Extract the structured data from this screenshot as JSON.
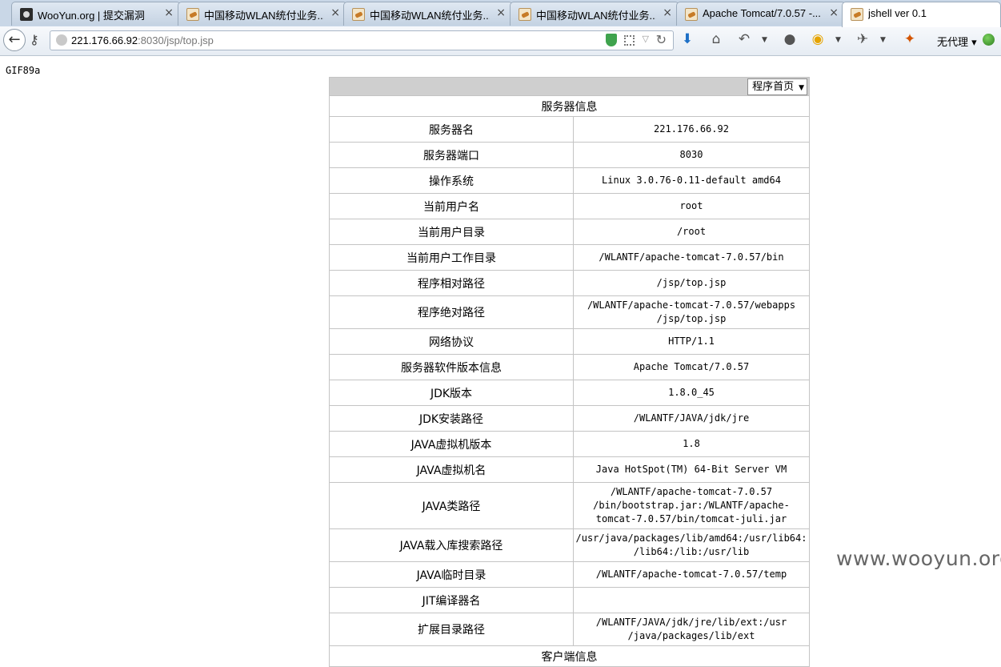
{
  "tabs": [
    {
      "title": "WooYun.org | 提交漏洞",
      "favicon": "wooyun-favicon",
      "active": false
    },
    {
      "title": "中国移动WLAN统付业务...",
      "favicon": "tomcat-favicon",
      "active": false
    },
    {
      "title": "中国移动WLAN统付业务...",
      "favicon": "tomcat-favicon",
      "active": false
    },
    {
      "title": "中国移动WLAN统付业务...",
      "favicon": "tomcat-favicon",
      "active": false
    },
    {
      "title": "Apache Tomcat/7.0.57 -...",
      "favicon": "tomcat-favicon",
      "active": false
    },
    {
      "title": "jshell ver 0.1",
      "favicon": "tomcat-favicon",
      "active": true
    }
  ],
  "tab_close_glyph": "×",
  "address_bar": {
    "host": "221.176.66.92",
    "rest": ":8030/jsp/top.jsp"
  },
  "toolbar": {
    "proxy_label": "无代理"
  },
  "page": {
    "gif_header": "GIF89a",
    "menu_select": "程序首页",
    "server_section_title": "服务器信息",
    "client_section_title": "客户端信息",
    "rows": [
      {
        "label": "服务器名",
        "value": "221.176.66.92"
      },
      {
        "label": "服务器端口",
        "value": "8030"
      },
      {
        "label": "操作系统",
        "value": "Linux 3.0.76-0.11-default amd64"
      },
      {
        "label": "当前用户名",
        "value": "root"
      },
      {
        "label": "当前用户目录",
        "value": "/root"
      },
      {
        "label": "当前用户工作目录",
        "value": "/WLANTF/apache-tomcat-7.0.57/bin"
      },
      {
        "label": "程序相对路径",
        "value": "/jsp/top.jsp"
      },
      {
        "label": "程序绝对路径",
        "value": "/WLANTF/apache-tomcat-7.0.57/webapps /jsp/top.jsp"
      },
      {
        "label": "网络协议",
        "value": "HTTP/1.1"
      },
      {
        "label": "服务器软件版本信息",
        "value": "Apache Tomcat/7.0.57"
      },
      {
        "label": "JDK版本",
        "value": "1.8.0_45"
      },
      {
        "label": "JDK安装路径",
        "value": "/WLANTF/JAVA/jdk/jre"
      },
      {
        "label": "JAVA虚拟机版本",
        "value": "1.8"
      },
      {
        "label": "JAVA虚拟机名",
        "value": "Java HotSpot(TM) 64-Bit Server VM"
      },
      {
        "label": "JAVA类路径",
        "value": "/WLANTF/apache-tomcat-7.0.57 /bin/bootstrap.jar:/WLANTF/apache-tomcat-7.0.57/bin/tomcat-juli.jar"
      },
      {
        "label": "JAVA载入库搜索路径",
        "value": "/usr/java/packages/lib/amd64:/usr/lib64: /lib64:/lib:/usr/lib"
      },
      {
        "label": "JAVA临时目录",
        "value": "/WLANTF/apache-tomcat-7.0.57/temp"
      },
      {
        "label": "JIT编译器名",
        "value": ""
      },
      {
        "label": "扩展目录路径",
        "value": "/WLANTF/JAVA/jdk/jre/lib/ext:/usr /java/packages/lib/ext"
      }
    ]
  },
  "watermark": "www.wooyun.org"
}
